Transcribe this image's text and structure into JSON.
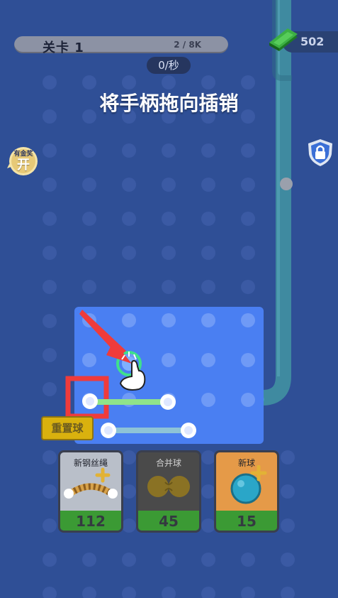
{
  "level": {
    "title": "关卡 1",
    "progress": "2 / 8K"
  },
  "rate": "0/秒",
  "instruction": "将手柄拖向插销",
  "currency": {
    "value": "502",
    "icon": "cash-stack-icon"
  },
  "lock": {
    "icon": "shield-lock-icon"
  },
  "bubble": {
    "top_text": "有金奖",
    "main_text": "开"
  },
  "reset_button": {
    "label": "重置球"
  },
  "cards": [
    {
      "label": "新钢丝绳",
      "count": "112",
      "icon": "rope-icon",
      "color": "#b9bfc9"
    },
    {
      "label": "合并球",
      "count": "45",
      "icon": "merge-balls-icon",
      "color": "#4a4a4a"
    },
    {
      "label": "新球",
      "count": "15",
      "icon": "new-ball-icon",
      "color": "#e59a48"
    }
  ],
  "colors": {
    "background": "#2f4f96",
    "play_area": "#4a7ff2",
    "rope_green": "#8fe38a",
    "rope_blue": "#8ec3d6",
    "highlight_red": "#ef3b3b",
    "pipe": "#3f8aa0"
  }
}
